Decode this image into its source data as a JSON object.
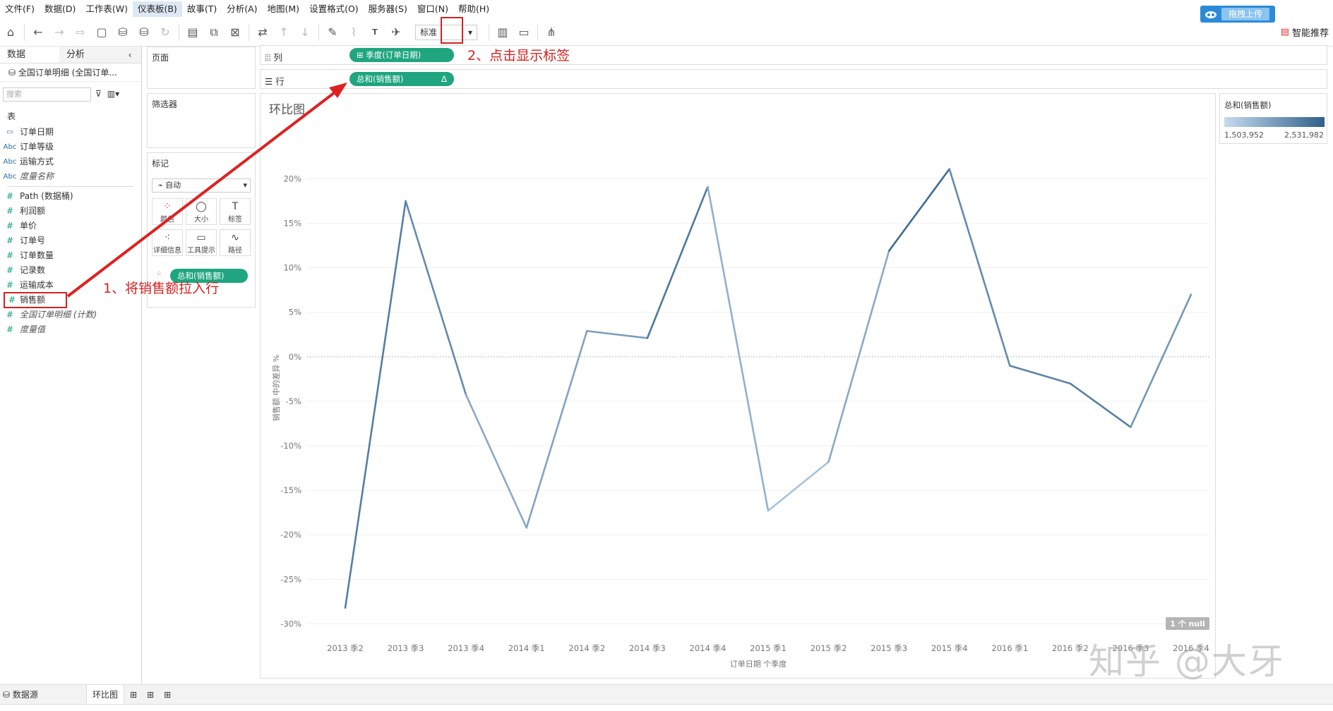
{
  "menu": [
    "文件(F)",
    "数据(D)",
    "工作表(W)",
    "仪表板(B)",
    "故事(T)",
    "分析(A)",
    "地图(M)",
    "设置格式(O)",
    "服务器(S)",
    "窗口(N)",
    "帮助(H)"
  ],
  "upload_label": "拖拽上传",
  "toolbar": {
    "fit_value": "标准",
    "smart_label": "智能推荐"
  },
  "left": {
    "tab_data": "数据",
    "tab_analysis": "分析",
    "datasource": "全国订单明细 (全国订单...",
    "search_placeholder": "搜索",
    "table_header": "表",
    "dimensions": [
      {
        "icon": "date",
        "name": "订单日期"
      },
      {
        "icon": "Abc",
        "name": "订单等级"
      },
      {
        "icon": "Abc",
        "name": "运输方式"
      },
      {
        "icon": "Abc",
        "name": "度量名称",
        "italic": true
      }
    ],
    "measures": [
      {
        "name": "Path (数据桶)"
      },
      {
        "name": "利润额"
      },
      {
        "name": "单价"
      },
      {
        "name": "订单号"
      },
      {
        "name": "订单数量"
      },
      {
        "name": "记录数"
      },
      {
        "name": "运输成本"
      },
      {
        "name": "销售额",
        "highlight": true
      },
      {
        "name": "全国订单明细 (计数)",
        "italic": true
      },
      {
        "name": "度量值",
        "italic": true
      }
    ]
  },
  "cards": {
    "pages": "页面",
    "filters": "筛选器",
    "marks": "标记",
    "mark_type": "自动",
    "mark_buttons": [
      "颜色",
      "大小",
      "标签",
      "详细信息",
      "工具提示",
      "路径"
    ],
    "mark_pill": "总和(销售额)"
  },
  "shelves": {
    "columns_label": "列",
    "columns_pill": "季度(订单日期)",
    "rows_label": "行",
    "rows_pill": "总和(销售额)"
  },
  "annotations": {
    "step1": "1、将销售额拉入行",
    "step2": "2、点击显示标签"
  },
  "legend": {
    "title": "总和(销售额)",
    "min": "1,503,952",
    "max": "2,531,982"
  },
  "chart_data": {
    "type": "line",
    "title": "环比图",
    "xlabel": "订单日期 个季度",
    "ylabel": "销售额 中的差异 %",
    "categories": [
      "2013 季2",
      "2013 季3",
      "2013 季4",
      "2014 季1",
      "2014 季2",
      "2014 季3",
      "2014 季4",
      "2015 季1",
      "2015 季2",
      "2015 季3",
      "2015 季4",
      "2016 季1",
      "2016 季2",
      "2016 季3",
      "2016 季4"
    ],
    "values": [
      -28.2,
      17.5,
      -4.3,
      -19.2,
      2.9,
      2.1,
      19.1,
      -17.3,
      -11.8,
      11.9,
      21.1,
      -1.0,
      -3.0,
      -7.9,
      7.0
    ],
    "color_values": [
      0.4,
      0.75,
      0.65,
      0.4,
      0.45,
      0.5,
      0.8,
      0.35,
      0.2,
      0.4,
      0.9,
      0.65,
      0.7,
      0.75,
      0.55
    ],
    "yticks": [
      "20%",
      "15%",
      "10%",
      "5%",
      "0%",
      "-5%",
      "-10%",
      "-15%",
      "-20%",
      "-25%",
      "-30%"
    ],
    "ylim": [
      -31,
      24
    ],
    "null_badge": "1 个 null",
    "grid": true,
    "color_scale": [
      "#c6dbef",
      "#2f5f8a"
    ]
  },
  "bottom": {
    "datasource_tab": "数据源",
    "sheet_tab": "环比图"
  },
  "watermark": "知乎 @大牙"
}
